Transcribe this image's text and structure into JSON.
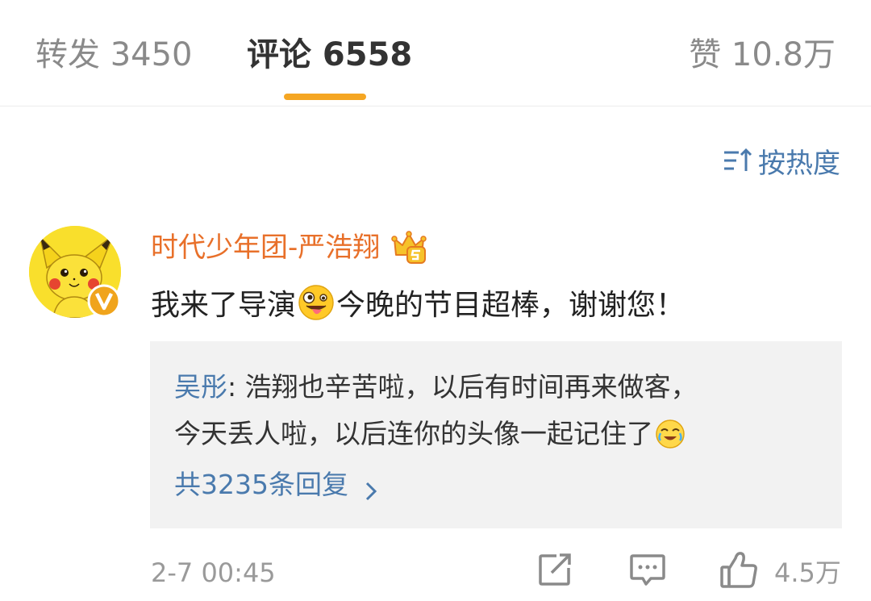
{
  "tabs": {
    "repost": "转发 3450",
    "comments": "评论 6558",
    "likes": "赞 10.8万"
  },
  "sort": {
    "label": "按热度",
    "icon": "sort-icon"
  },
  "comment": {
    "username": "时代少年团-严浩翔",
    "text_before_emoji": "我来了导演",
    "emoji": "crazy-face-emoji",
    "text_after_emoji": "今晚的节目超棒，谢谢您！",
    "reply": {
      "author": "吴彤",
      "separator": ": ",
      "line1": "浩翔也辛苦啦，以后有时间再来做客，",
      "line2": "今天丢人啦，以后连你的头像一起记住了",
      "emoji": "laughing-tears-emoji",
      "more_label": "共3235条回复"
    },
    "timestamp": "2-7 00:45",
    "like_count": "4.5万"
  },
  "colors": {
    "accent": "#f5a623",
    "username": "#e8702a",
    "link": "#4a7aad",
    "muted": "#9a9a9a"
  }
}
